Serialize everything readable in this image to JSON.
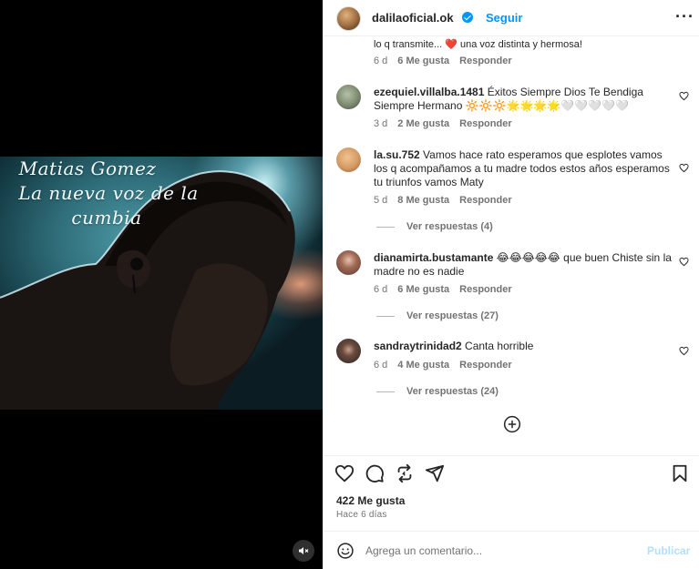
{
  "media": {
    "overlay_lines": [
      "Matias Gomez",
      "La nueva voz de la",
      "cumbia"
    ]
  },
  "header": {
    "username": "dalilaoficial.ok",
    "separator": "•",
    "follow_label": "Seguir",
    "more_label": "···"
  },
  "comments": [
    {
      "username": "",
      "text": "lo q transmite... ❤️ una voz distinta y hermosa!",
      "time": "6 d",
      "likes": "6 Me gusta",
      "reply": "Responder",
      "avatar_color": "#c88b5a"
    },
    {
      "username": "ezequiel.villalba.1481",
      "text": "Éxitos Siempre Dios Te Bendiga Siempre Hermano 🔆🔆🔆🌟🌟🌟🌟🤍🤍🤍🤍🤍",
      "time": "3 d",
      "likes": "2 Me gusta",
      "reply": "Responder",
      "avatar_color": "#7b8a6f"
    },
    {
      "username": "la.su.752",
      "text": "Vamos hace rato esperamos que esplotes vamos los q acompañamos a tu madre todos estos años esperamos tu triunfos vamos Maty",
      "time": "5 d",
      "likes": "8 Me gusta",
      "reply": "Responder",
      "replies": "Ver respuestas (4)",
      "avatar_color": "#d49a63"
    },
    {
      "username": "dianamirta.bustamante",
      "text": "😂😂😂😂😂 que buen Chiste sin la madre no es nadie",
      "time": "6 d",
      "likes": "6 Me gusta",
      "reply": "Responder",
      "replies": "Ver respuestas (27)",
      "avatar_color": "#5a3a33"
    },
    {
      "username": "sandraytrinidad2",
      "text": "Canta horrible",
      "time": "6 d",
      "likes": "4 Me gusta",
      "reply": "Responder",
      "replies": "Ver respuestas (24)",
      "avatar_color": "#2b2320"
    }
  ],
  "actions": {
    "likes": "422 Me gusta",
    "ago": "Hace 6 días"
  },
  "composer": {
    "placeholder": "Agrega un comentario...",
    "post_label": "Publicar"
  },
  "colors": {
    "accent": "#0095f6",
    "post_disabled": "#b2dffc",
    "muted_text": "#737373"
  }
}
